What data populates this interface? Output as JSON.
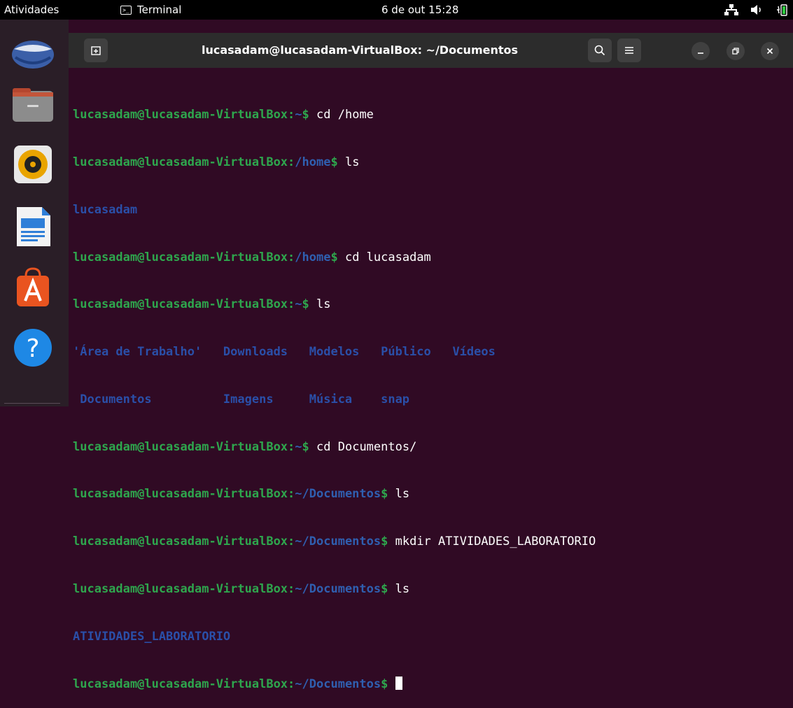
{
  "topbar": {
    "activities": "Atividades",
    "app_name": "Terminal",
    "clock": "6 de out  15:28"
  },
  "window": {
    "title": "lucasadam@lucasadam-VirtualBox: ~/Documentos"
  },
  "terminal": {
    "prompt_user": "lucasadam@lucasadam-VirtualBox",
    "prompt_sep": ":",
    "lines": [
      {
        "path": "~",
        "cmd": " cd /home"
      },
      {
        "path": "/home",
        "cmd": " ls"
      },
      {
        "path": "/home",
        "cmd": " cd lucasadam"
      },
      {
        "path": "~",
        "cmd": " ls"
      },
      {
        "path": "~",
        "cmd": " cd Documentos/"
      },
      {
        "path": "~/Documentos",
        "cmd": " ls"
      },
      {
        "path": "~/Documentos",
        "cmd": " mkdir ATIVIDADES_LABORATORIO"
      },
      {
        "path": "~/Documentos",
        "cmd": " ls"
      },
      {
        "path": "~/Documentos",
        "cmd": " "
      }
    ],
    "output_home": "lucasadam",
    "output_ls_home": {
      "row1": "'Área de Trabalho'   Downloads   Modelos   Público   Vídeos",
      "row2": " Documentos          Imagens     Música    snap"
    },
    "output_documentos": "ATIVIDADES_LABORATORIO",
    "colors": {
      "background": "#300a24",
      "prompt_user": "#2ea64d",
      "prompt_path": "#2f5fb0",
      "directory": "#2a4fa8"
    }
  },
  "dock": {
    "icons": [
      "thunderbird-icon",
      "files-icon",
      "rhythmbox-icon",
      "writer-icon",
      "software-icon",
      "help-icon"
    ]
  }
}
